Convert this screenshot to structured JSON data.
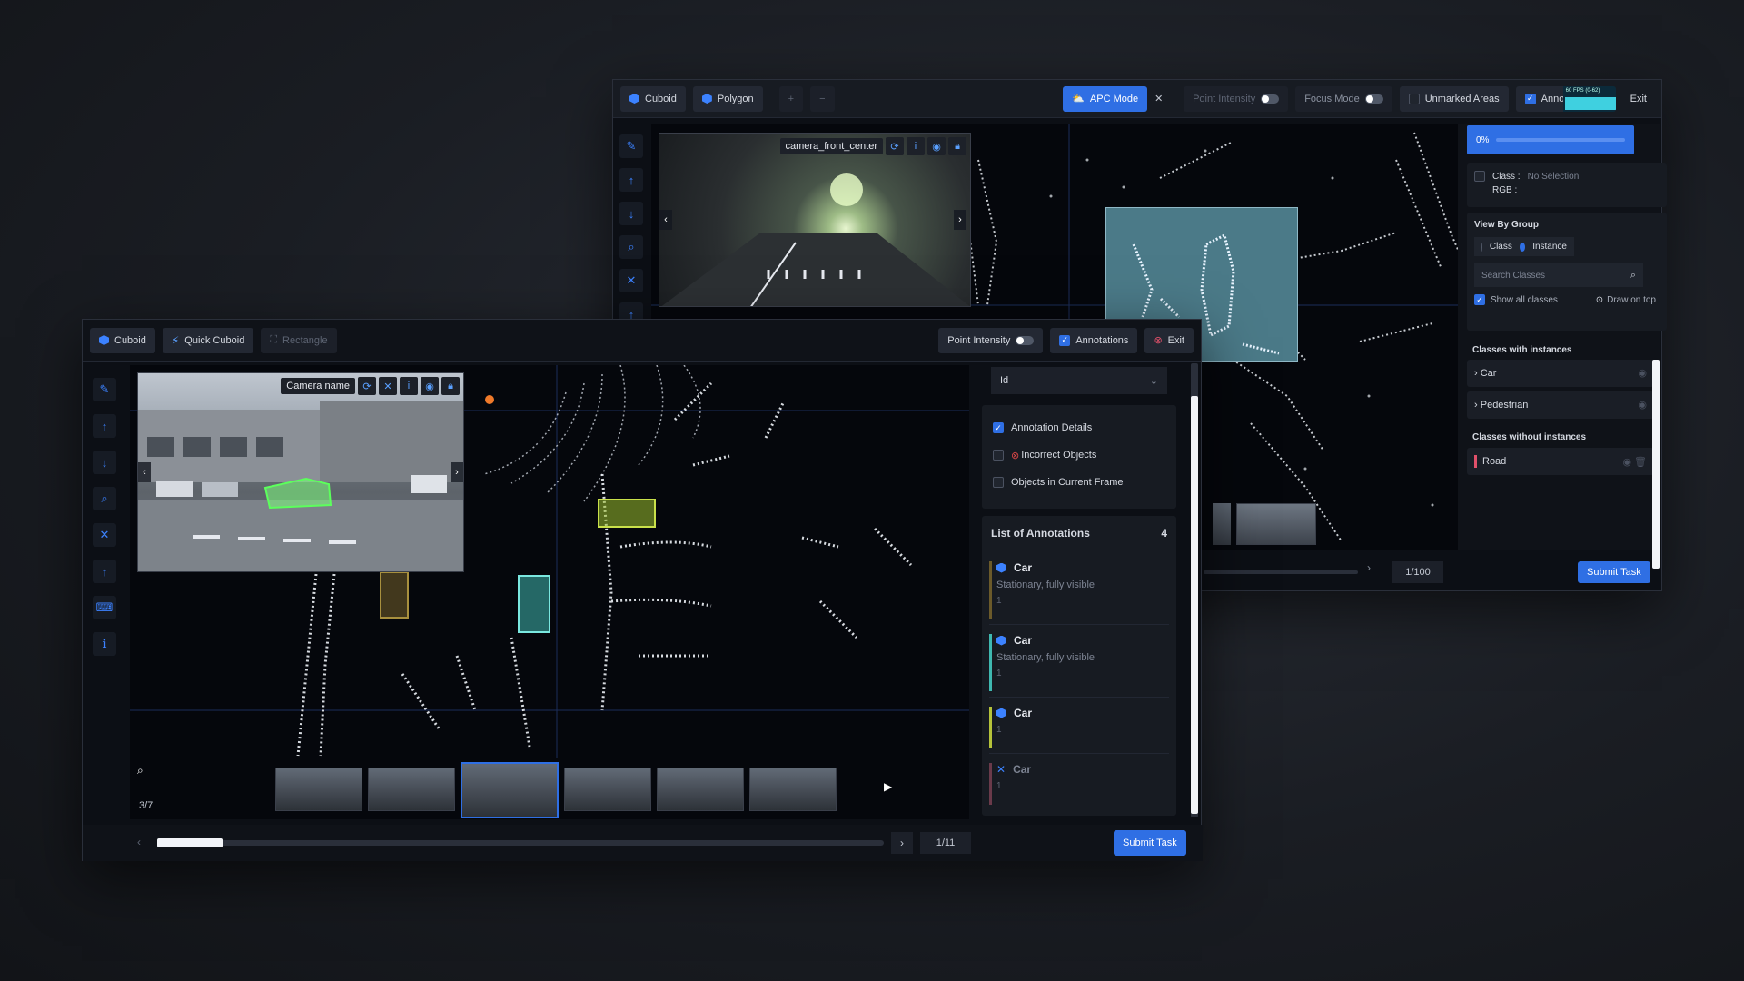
{
  "back": {
    "toolbar": {
      "cuboid": "Cuboid",
      "polygon": "Polygon",
      "plus": "+",
      "minus": "−",
      "apc_mode": "APC Mode",
      "close": "✕",
      "point_intensity": "Point Intensity",
      "focus_mode": "Focus Mode",
      "unmarked_areas": "Unmarked Areas",
      "annotations": "Annota",
      "fps": "60 FPS (0-62)",
      "exit": "Exit"
    },
    "camera_name": "camera_front_center",
    "progress": "0%",
    "class_label": "Class :",
    "class_value": "No Selection",
    "rgb_label": "RGB :",
    "view_by_group": "View By Group",
    "group_options": [
      "Class",
      "Instance"
    ],
    "search_placeholder": "Search Classes",
    "show_all_classes": "Show all classes",
    "draw_on_top": "Draw on top",
    "classes_with_instances": "Classes with instances",
    "with_instances": [
      "Car",
      "Pedestrian"
    ],
    "classes_without_instances": "Classes without instances",
    "without_instances": [
      "Road"
    ],
    "frame_counter": "1/100",
    "submit": "Submit Task"
  },
  "front": {
    "toolbar": {
      "cuboid": "Cuboid",
      "quick_cuboid": "Quick Cuboid",
      "rectangle": "Rectangle",
      "point_intensity": "Point Intensity",
      "annotations": "Annotations",
      "exit": "Exit"
    },
    "camera_name": "Camera name",
    "dropdown_value": "Id",
    "filters": [
      {
        "label": "Annotation Details",
        "checked": true
      },
      {
        "label": "Incorrect Objects",
        "checked": false
      },
      {
        "label": "Objects in Current Frame",
        "checked": false
      }
    ],
    "list_title": "List of Annotations",
    "list_count": "4",
    "annotations": [
      {
        "label": "Car",
        "status": "Stationary, fully visible",
        "id": "1",
        "color": "#6b5a2a"
      },
      {
        "label": "Car",
        "status": "Stationary, fully visible",
        "id": "1",
        "color": "#3fb8b0"
      },
      {
        "label": "Car",
        "status": "",
        "id": "1",
        "color": "#b5c23a"
      },
      {
        "label": "Car",
        "status": "",
        "id": "1",
        "color": "#6a3a4a"
      }
    ],
    "camera_counter": "3/7",
    "frame_counter": "1/11",
    "timeline_progress": 0.09,
    "submit": "Submit Task"
  },
  "colors": {
    "accent": "#2f6fe4",
    "background": "#0c0f15",
    "panel": "#171b22"
  }
}
